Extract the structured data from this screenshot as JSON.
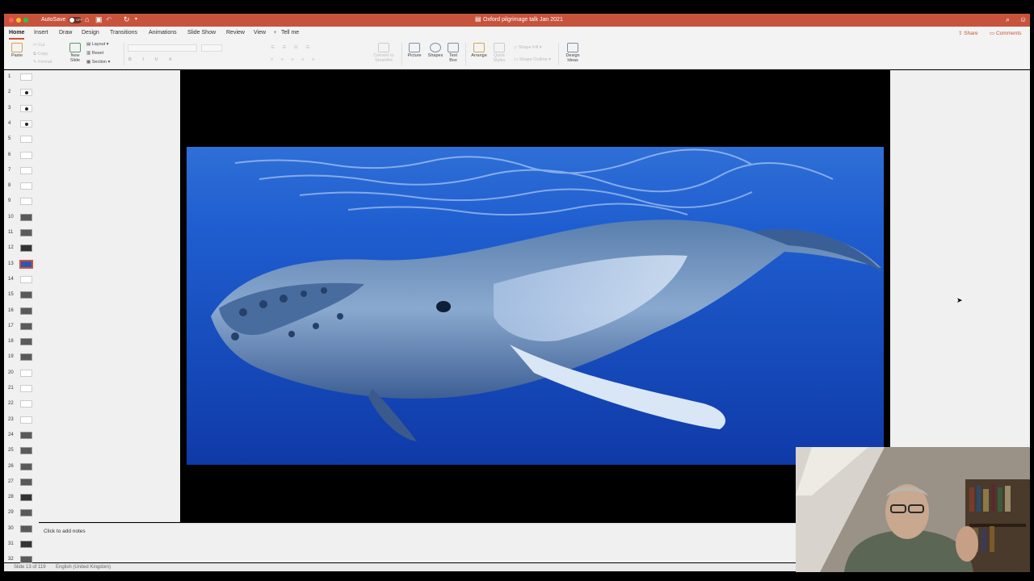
{
  "window": {
    "title": "Oxford pilgrimage talk Jan 2021",
    "autosave_label": "AutoSave",
    "autosave_state": "OFF"
  },
  "ribbon_tabs": [
    "Home",
    "Insert",
    "Draw",
    "Design",
    "Transitions",
    "Animations",
    "Slide Show",
    "Review",
    "View"
  ],
  "tell_me": "Tell me",
  "share_label": "Share",
  "comments_label": "Comments",
  "ribbon": {
    "paste": "Paste",
    "cut": "Cut",
    "copy": "Copy",
    "format": "Format",
    "new_slide": "New Slide",
    "layout": "Layout",
    "reset": "Reset",
    "section": "Section",
    "convert_smartart": "Convert to SmartArt",
    "picture": "Picture",
    "shapes": "Shapes",
    "text_box": "Text Box",
    "arrange": "Arrange",
    "quick_styles": "Quick Styles",
    "shape_fill": "Shape Fill",
    "shape_outline": "Shape Outline",
    "design_ideas": "Design Ideas"
  },
  "slides": [
    {
      "n": "1",
      "kind": "blank"
    },
    {
      "n": "2",
      "kind": "dot"
    },
    {
      "n": "3",
      "kind": "dot"
    },
    {
      "n": "4",
      "kind": "dot"
    },
    {
      "n": "5",
      "kind": "blank"
    },
    {
      "n": "6",
      "kind": "blank"
    },
    {
      "n": "7",
      "kind": "blank"
    },
    {
      "n": "8",
      "kind": "blank"
    },
    {
      "n": "9",
      "kind": "blank"
    },
    {
      "n": "10",
      "kind": "photo"
    },
    {
      "n": "11",
      "kind": "photo"
    },
    {
      "n": "12",
      "kind": "dark"
    },
    {
      "n": "13",
      "kind": "selected"
    },
    {
      "n": "14",
      "kind": "blank"
    },
    {
      "n": "15",
      "kind": "photo"
    },
    {
      "n": "16",
      "kind": "photo"
    },
    {
      "n": "17",
      "kind": "photo"
    },
    {
      "n": "18",
      "kind": "photo"
    },
    {
      "n": "19",
      "kind": "photo"
    },
    {
      "n": "20",
      "kind": "blank"
    },
    {
      "n": "21",
      "kind": "blank"
    },
    {
      "n": "22",
      "kind": "blank"
    },
    {
      "n": "23",
      "kind": "blank"
    },
    {
      "n": "24",
      "kind": "photo"
    },
    {
      "n": "25",
      "kind": "photo"
    },
    {
      "n": "26",
      "kind": "photo"
    },
    {
      "n": "27",
      "kind": "photo"
    },
    {
      "n": "28",
      "kind": "dark"
    },
    {
      "n": "29",
      "kind": "photo"
    },
    {
      "n": "30",
      "kind": "photo"
    },
    {
      "n": "31",
      "kind": "dark"
    },
    {
      "n": "32",
      "kind": "photo"
    }
  ],
  "notes_placeholder": "Click to add notes",
  "status": {
    "slide_indicator": "Slide 13 of 119",
    "language": "English (United Kingdom)"
  },
  "colors": {
    "accent": "#c8533d",
    "ocean": "#1a4fc4"
  }
}
